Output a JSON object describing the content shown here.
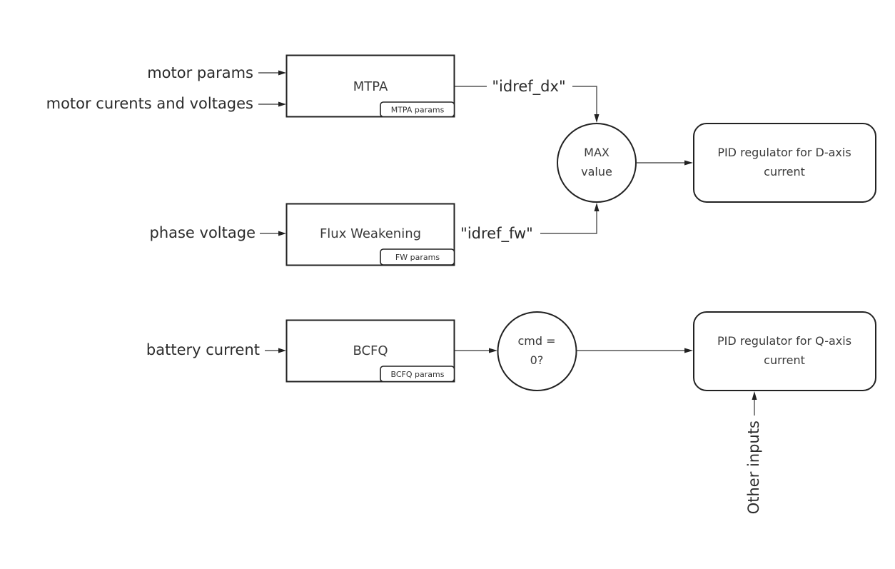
{
  "diagram": {
    "inputs": {
      "motor_params": "motor params",
      "motor_currents_voltages": "motor curents and voltages",
      "phase_voltage": "phase voltage",
      "battery_current": "battery current",
      "other_inputs": "Other inputs"
    },
    "blocks": {
      "mtpa": {
        "label": "MTPA",
        "params_label": "MTPA params"
      },
      "flux_weakening": {
        "label": "Flux Weakening",
        "params_label": "FW params"
      },
      "bcfq": {
        "label": "BCFQ",
        "params_label": "BCFQ params"
      }
    },
    "signals": {
      "idref_dx": "\"idref_dx\"",
      "idref_fw": "\"idref_fw\""
    },
    "nodes": {
      "max_value": {
        "line1": "MAX",
        "line2": "value"
      },
      "cmd_zero": {
        "line1": "cmd =",
        "line2": "0?"
      }
    },
    "regulators": {
      "d_axis": {
        "line1": "PID regulator for D-axis",
        "line2": "current"
      },
      "q_axis": {
        "line1": "PID regulator for Q-axis",
        "line2": "current"
      }
    }
  }
}
